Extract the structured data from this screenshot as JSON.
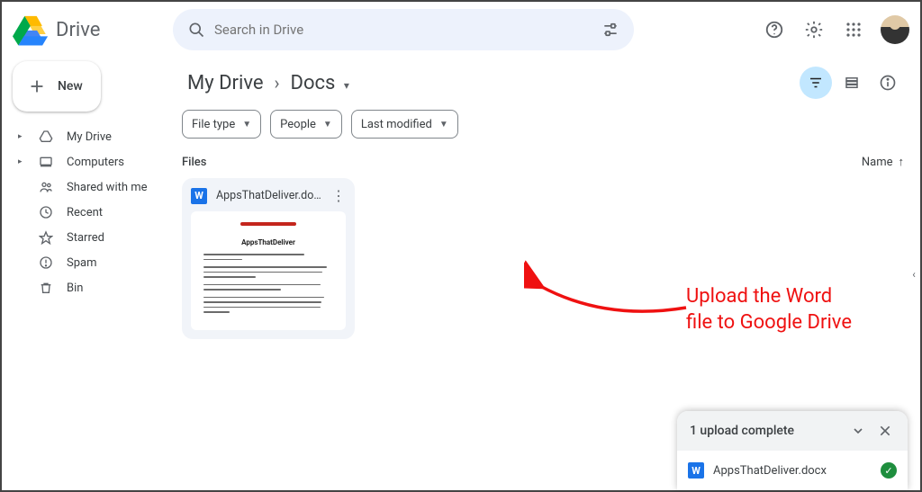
{
  "header": {
    "product_name": "Drive",
    "search_placeholder": "Search in Drive"
  },
  "sidebar": {
    "new_label": "New",
    "items": [
      {
        "label": "My Drive",
        "icon": "mydrive",
        "has_children": true
      },
      {
        "label": "Computers",
        "icon": "computers",
        "has_children": true
      },
      {
        "label": "Shared with me",
        "icon": "shared"
      },
      {
        "label": "Recent",
        "icon": "recent"
      },
      {
        "label": "Starred",
        "icon": "starred"
      },
      {
        "label": "Spam",
        "icon": "spam"
      },
      {
        "label": "Bin",
        "icon": "bin"
      }
    ]
  },
  "breadcrumb": {
    "root": "My Drive",
    "current": "Docs"
  },
  "chips": {
    "0": {
      "label": "File type"
    },
    "1": {
      "label": "People"
    },
    "2": {
      "label": "Last modified"
    }
  },
  "files_section": {
    "heading": "Files",
    "sort_label": "Name"
  },
  "file": {
    "name": "AppsThatDeliver.docx",
    "preview_title": "AppsThatDeliver"
  },
  "annotation": {
    "line1": "Upload the Word",
    "line2": "file to Google Drive"
  },
  "upload_toast": {
    "title": "1 upload complete",
    "item_name": "AppsThatDeliver.docx"
  }
}
